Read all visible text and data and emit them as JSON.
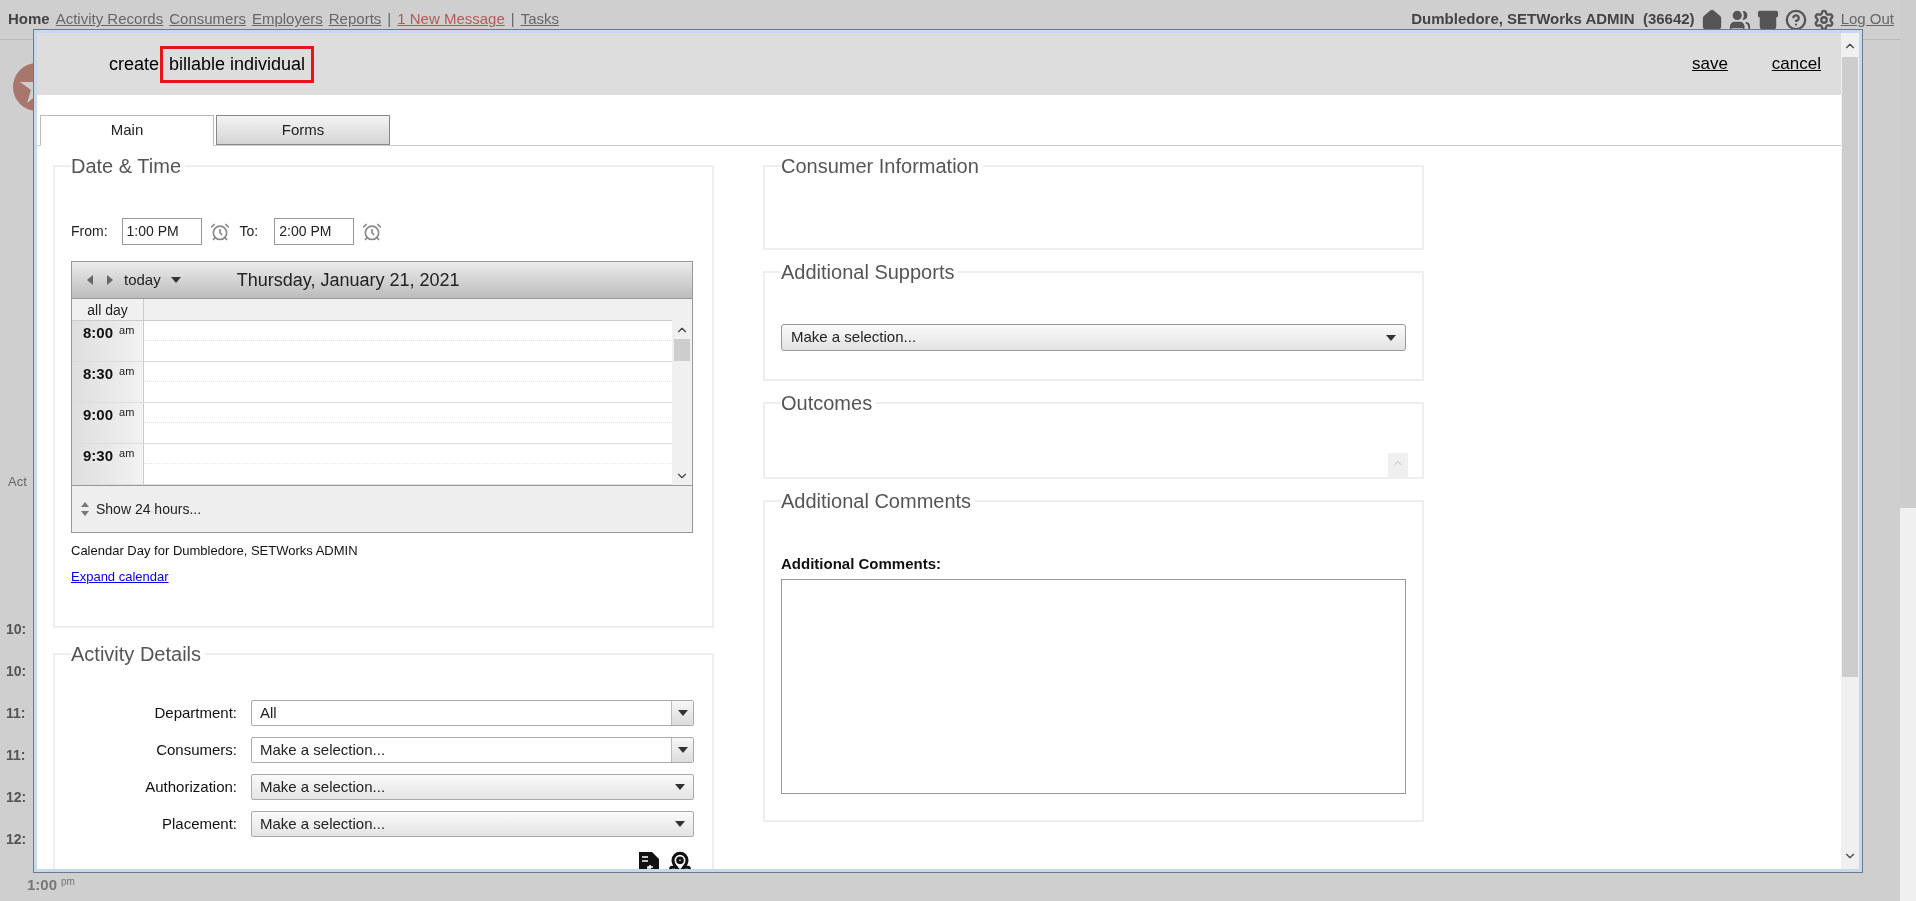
{
  "nav": {
    "items": [
      {
        "label": "Home",
        "kind": "current"
      },
      {
        "label": "Activity Records",
        "kind": "link"
      },
      {
        "label": "Consumers",
        "kind": "link"
      },
      {
        "label": "Employers",
        "kind": "link"
      },
      {
        "label": "Reports",
        "kind": "link"
      },
      {
        "label": "|",
        "kind": "separator"
      },
      {
        "label": "1 New Message",
        "kind": "alert"
      },
      {
        "label": "|",
        "kind": "separator"
      },
      {
        "label": "Tasks",
        "kind": "link"
      }
    ],
    "user": "Dumbledore, SETWorks ADMIN  (36642)",
    "logout": "Log Out"
  },
  "background": {
    "left_fragment": "Act",
    "time_fragments": [
      "10:",
      "10:",
      "11:",
      "11:",
      "12:",
      "12:"
    ],
    "bottom_time": "1:00",
    "bottom_meridiem": "pm"
  },
  "dialog": {
    "title_prefix": "create",
    "title_highlight": "billable individual",
    "highlighted": true,
    "actions": [
      "save",
      "cancel"
    ],
    "tabs": [
      {
        "label": "Main",
        "selected": true
      },
      {
        "label": "Forms",
        "selected": false
      }
    ],
    "date_time": {
      "title": "Date & Time",
      "from_label": "From:",
      "from_value": "1:00 PM",
      "to_label": "To:",
      "to_value": "2:00 PM",
      "calendar": {
        "today": "today",
        "date": "Thursday, January 21, 2021",
        "all_day": "all day",
        "slots": [
          {
            "time": "8:00",
            "meridiem": "am"
          },
          {
            "time": "8:30",
            "meridiem": "am"
          },
          {
            "time": "9:00",
            "meridiem": "am"
          },
          {
            "time": "9:30",
            "meridiem": "am"
          }
        ],
        "show_more": "Show 24 hours...",
        "caption": "Calendar Day for Dumbledore, SETWorks ADMIN",
        "expand_link": "Expand calendar"
      }
    },
    "activity_details": {
      "title": "Activity Details",
      "fields": [
        {
          "label": "Department:",
          "value": "All",
          "kind": "combo"
        },
        {
          "label": "Consumers:",
          "value": "Make a selection...",
          "kind": "combo"
        },
        {
          "label": "Authorization:",
          "value": "Make a selection...",
          "kind": "select"
        },
        {
          "label": "Placement:",
          "value": "Make a selection...",
          "kind": "select"
        }
      ]
    },
    "consumer_information": {
      "title": "Consumer Information"
    },
    "additional_supports": {
      "title": "Additional Supports",
      "select": "Make a selection..."
    },
    "outcomes": {
      "title": "Outcomes"
    },
    "additional_comments": {
      "title": "Additional Comments",
      "label": "Additional Comments:"
    }
  }
}
